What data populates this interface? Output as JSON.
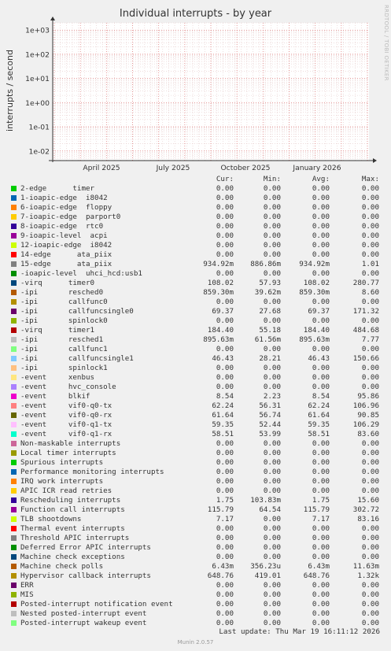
{
  "title": "Individual interrupts - by year",
  "side_label": "RRDTOOL / TOBI OETIKER",
  "footer": "Munin 2.0.57",
  "last_update": "Last update: Thu Mar 19 16:11:12 2026",
  "legend_headers": [
    "Cur:",
    "Min:",
    "Avg:",
    "Max:"
  ],
  "chart_data": {
    "type": "line",
    "title": "Individual interrupts - by year",
    "ylabel": "interrupts / second",
    "y_scale": "log",
    "ylim": [
      0.004,
      2000
    ],
    "y_ticks": [
      "1e+03",
      "1e+02",
      "1e+01",
      "1e+00",
      "1e-01",
      "1e-02"
    ],
    "x_ticks": [
      "April 2025",
      "July 2025",
      "October 2025",
      "January 2026"
    ],
    "grid": true,
    "series": [
      {
        "name": "2-edge      timer",
        "color": "#00cc00",
        "cur": "0.00",
        "min": "0.00",
        "avg": "0.00",
        "max": "0.00"
      },
      {
        "name": "1-ioapic-edge  i8042",
        "color": "#0066b3",
        "cur": "0.00",
        "min": "0.00",
        "avg": "0.00",
        "max": "0.00"
      },
      {
        "name": "6-ioapic-edge  floppy",
        "color": "#ff8000",
        "cur": "0.00",
        "min": "0.00",
        "avg": "0.00",
        "max": "0.00"
      },
      {
        "name": "7-ioapic-edge  parport0",
        "color": "#ffcc00",
        "cur": "0.00",
        "min": "0.00",
        "avg": "0.00",
        "max": "0.00"
      },
      {
        "name": "8-ioapic-edge  rtc0",
        "color": "#330099",
        "cur": "0.00",
        "min": "0.00",
        "avg": "0.00",
        "max": "0.00"
      },
      {
        "name": "9-ioapic-level  acpi",
        "color": "#990099",
        "cur": "0.00",
        "min": "0.00",
        "avg": "0.00",
        "max": "0.00"
      },
      {
        "name": "12-ioapic-edge  i8042",
        "color": "#ccff00",
        "cur": "0.00",
        "min": "0.00",
        "avg": "0.00",
        "max": "0.00"
      },
      {
        "name": "14-edge      ata_piix",
        "color": "#ff0000",
        "cur": "0.00",
        "min": "0.00",
        "avg": "0.00",
        "max": "0.00"
      },
      {
        "name": "15-edge      ata_piix",
        "color": "#808080",
        "cur": "934.92m",
        "min": "886.86m",
        "avg": "934.92m",
        "max": "1.01"
      },
      {
        "name": "-ioapic-level  uhci_hcd:usb1",
        "color": "#008f00",
        "cur": "0.00",
        "min": "0.00",
        "avg": "0.00",
        "max": "0.00"
      },
      {
        "name": "-virq      timer0",
        "color": "#00487d",
        "cur": "108.02",
        "min": "57.93",
        "avg": "108.02",
        "max": "280.77"
      },
      {
        "name": "-ipi       resched0",
        "color": "#b35a00",
        "cur": "859.30m",
        "min": "39.62m",
        "avg": "859.30m",
        "max": "8.60"
      },
      {
        "name": "-ipi       callfunc0",
        "color": "#b38f00",
        "cur": "0.00",
        "min": "0.00",
        "avg": "0.00",
        "max": "0.00"
      },
      {
        "name": "-ipi       callfuncsingle0",
        "color": "#6b006b",
        "cur": "69.37",
        "min": "27.68",
        "avg": "69.37",
        "max": "171.32"
      },
      {
        "name": "-ipi       spinlock0",
        "color": "#8fb300",
        "cur": "0.00",
        "min": "0.00",
        "avg": "0.00",
        "max": "0.00"
      },
      {
        "name": "-virq      timer1",
        "color": "#b30000",
        "cur": "184.40",
        "min": "55.18",
        "avg": "184.40",
        "max": "484.68"
      },
      {
        "name": "-ipi       resched1",
        "color": "#bebebe",
        "cur": "895.63m",
        "min": "61.56m",
        "avg": "895.63m",
        "max": "7.77"
      },
      {
        "name": "-ipi       callfunc1",
        "color": "#80ff80",
        "cur": "0.00",
        "min": "0.00",
        "avg": "0.00",
        "max": "0.00"
      },
      {
        "name": "-ipi       callfuncsingle1",
        "color": "#80c9ff",
        "cur": "46.43",
        "min": "28.21",
        "avg": "46.43",
        "max": "150.66"
      },
      {
        "name": "-ipi       spinlock1",
        "color": "#ffc080",
        "cur": "0.00",
        "min": "0.00",
        "avg": "0.00",
        "max": "0.00"
      },
      {
        "name": "-event     xenbus",
        "color": "#ffe680",
        "cur": "0.00",
        "min": "0.00",
        "avg": "0.00",
        "max": "0.00"
      },
      {
        "name": "-event     hvc_console",
        "color": "#aa80ff",
        "cur": "0.00",
        "min": "0.00",
        "avg": "0.00",
        "max": "0.00"
      },
      {
        "name": "-event     blkif",
        "color": "#ee00cc",
        "cur": "8.54",
        "min": "2.23",
        "avg": "8.54",
        "max": "95.86"
      },
      {
        "name": "-event     vif0-q0-tx",
        "color": "#ff8080",
        "cur": "62.24",
        "min": "56.31",
        "avg": "62.24",
        "max": "106.96"
      },
      {
        "name": "-event     vif0-q0-rx",
        "color": "#666600",
        "cur": "61.64",
        "min": "56.74",
        "avg": "61.64",
        "max": "90.85"
      },
      {
        "name": "-event     vif0-q1-tx",
        "color": "#ffbfff",
        "cur": "59.35",
        "min": "52.44",
        "avg": "59.35",
        "max": "106.29"
      },
      {
        "name": "-event     vif0-q1-rx",
        "color": "#00ffcc",
        "cur": "58.51",
        "min": "53.99",
        "avg": "58.51",
        "max": "83.60"
      },
      {
        "name": "Non-maskable interrupts",
        "color": "#cc6699",
        "cur": "0.00",
        "min": "0.00",
        "avg": "0.00",
        "max": "0.00"
      },
      {
        "name": "Local timer interrupts",
        "color": "#999900",
        "cur": "0.00",
        "min": "0.00",
        "avg": "0.00",
        "max": "0.00"
      },
      {
        "name": "Spurious interrupts",
        "color": "#00cc00",
        "cur": "0.00",
        "min": "0.00",
        "avg": "0.00",
        "max": "0.00"
      },
      {
        "name": "Performance monitoring interrupts",
        "color": "#0066b3",
        "cur": "0.00",
        "min": "0.00",
        "avg": "0.00",
        "max": "0.00"
      },
      {
        "name": "IRQ work interrupts",
        "color": "#ff8000",
        "cur": "0.00",
        "min": "0.00",
        "avg": "0.00",
        "max": "0.00"
      },
      {
        "name": "APIC ICR read retries",
        "color": "#ffcc00",
        "cur": "0.00",
        "min": "0.00",
        "avg": "0.00",
        "max": "0.00"
      },
      {
        "name": "Rescheduling interrupts",
        "color": "#330099",
        "cur": "1.75",
        "min": "103.83m",
        "avg": "1.75",
        "max": "15.60"
      },
      {
        "name": "Function call interrupts",
        "color": "#990099",
        "cur": "115.79",
        "min": "64.54",
        "avg": "115.79",
        "max": "302.72"
      },
      {
        "name": "TLB shootdowns",
        "color": "#ccff00",
        "cur": "7.17",
        "min": "0.00",
        "avg": "7.17",
        "max": "83.16"
      },
      {
        "name": "Thermal event interrupts",
        "color": "#ff0000",
        "cur": "0.00",
        "min": "0.00",
        "avg": "0.00",
        "max": "0.00"
      },
      {
        "name": "Threshold APIC interrupts",
        "color": "#808080",
        "cur": "0.00",
        "min": "0.00",
        "avg": "0.00",
        "max": "0.00"
      },
      {
        "name": "Deferred Error APIC interrupts",
        "color": "#008f00",
        "cur": "0.00",
        "min": "0.00",
        "avg": "0.00",
        "max": "0.00"
      },
      {
        "name": "Machine check exceptions",
        "color": "#00487d",
        "cur": "0.00",
        "min": "0.00",
        "avg": "0.00",
        "max": "0.00"
      },
      {
        "name": "Machine check polls",
        "color": "#b35a00",
        "cur": "6.43m",
        "min": "356.23u",
        "avg": "6.43m",
        "max": "11.63m"
      },
      {
        "name": "Hypervisor callback interrupts",
        "color": "#b38f00",
        "cur": "648.76",
        "min": "419.01",
        "avg": "648.76",
        "max": "1.32k"
      },
      {
        "name": "ERR",
        "color": "#6b006b",
        "cur": "0.00",
        "min": "0.00",
        "avg": "0.00",
        "max": "0.00"
      },
      {
        "name": "MIS",
        "color": "#8fb300",
        "cur": "0.00",
        "min": "0.00",
        "avg": "0.00",
        "max": "0.00"
      },
      {
        "name": "Posted-interrupt notification event",
        "color": "#b30000",
        "cur": "0.00",
        "min": "0.00",
        "avg": "0.00",
        "max": "0.00"
      },
      {
        "name": "Nested posted-interrupt event",
        "color": "#bebebe",
        "cur": "0.00",
        "min": "0.00",
        "avg": "0.00",
        "max": "0.00"
      },
      {
        "name": "Posted-interrupt wakeup event",
        "color": "#80ff80",
        "cur": "0.00",
        "min": "0.00",
        "avg": "0.00",
        "max": "0.00"
      }
    ]
  }
}
